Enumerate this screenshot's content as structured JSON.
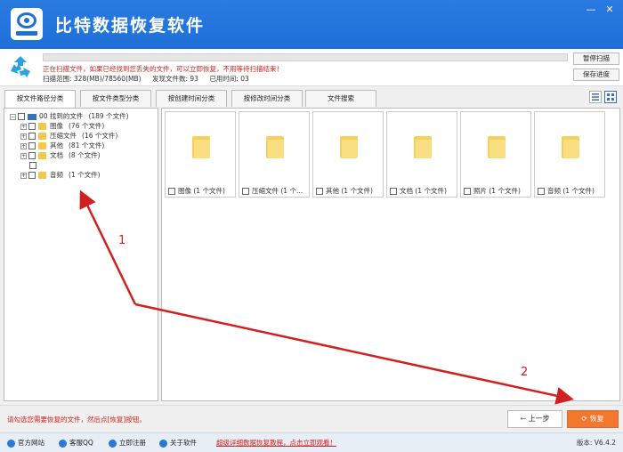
{
  "app": {
    "title": "比特数据恢复软件"
  },
  "colors": {
    "brand_blue": "#1e6fd8",
    "warn_red": "#d02020",
    "orange": "#f4772e",
    "folder_yellow": "#f6cf5c"
  },
  "window": {
    "minimize": "—",
    "close": "✕"
  },
  "scan": {
    "message": "正在扫描文件，如果已经找到您丢失的文件，可以立即恢复，不用等待扫描结束！",
    "range": "扫描范围: 328(MB)/78560(MB)",
    "found": "发现文件数: 93",
    "elapsed": "已用时间: 03",
    "pause_label": "暂停扫描",
    "save_label": "保存进度"
  },
  "tabs": [
    {
      "label": "按文件路径分类"
    },
    {
      "label": "按文件类型分类"
    },
    {
      "label": "按创建时间分类"
    },
    {
      "label": "按修改时间分类"
    },
    {
      "label": "文件搜索"
    }
  ],
  "tree": {
    "root": {
      "name": "00 找到的文件",
      "count": "(189 个文件)"
    },
    "children": [
      {
        "name": "图像",
        "count": "(76 个文件)"
      },
      {
        "name": "压缩文件",
        "count": "(16 个文件)"
      },
      {
        "name": "其他",
        "count": "(81 个文件)"
      },
      {
        "name": "文档",
        "count": "(8 个文件)"
      },
      {
        "name": "音频",
        "count": "(1 个文件)"
      }
    ]
  },
  "cards": [
    {
      "label": "图像  (1 个文件)"
    },
    {
      "label": "压缩文件 (1 个..."
    },
    {
      "label": "其他  (1 个文件)"
    },
    {
      "label": "文档  (1 个文件)"
    },
    {
      "label": "照片  (1 个文件)"
    },
    {
      "label": "音频  (1 个文件)"
    }
  ],
  "actions": {
    "hint": "请勾选您需要恢复的文件，然后点[恢复]按钮。",
    "prev_label": "上一步",
    "recover_label": "恢复"
  },
  "footer": {
    "links": [
      {
        "label": "官方网站"
      },
      {
        "label": "客服QQ"
      },
      {
        "label": "立即注册"
      },
      {
        "label": "关于软件"
      }
    ],
    "promo": "超级详细数据恢复教程，点击立即观看！",
    "version": "版本: V6.4.2"
  },
  "annotations": {
    "one": "1",
    "two": "2"
  }
}
